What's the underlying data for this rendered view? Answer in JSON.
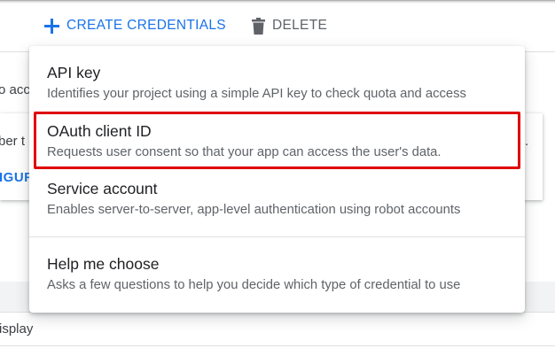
{
  "toolbar": {
    "create_label": "CREATE CREDENTIALS",
    "delete_label": "DELETE"
  },
  "background": {
    "fragment_1": "o acc",
    "fragment_2": "ber t",
    "fragment_3": "IGUR",
    "fragment_4": "isplay"
  },
  "menu": {
    "items": [
      {
        "title": "API key",
        "description": "Identifies your project using a simple API key to check quota and access"
      },
      {
        "title": "OAuth client ID",
        "description": "Requests user consent so that your app can access the user's data."
      },
      {
        "title": "Service account",
        "description": "Enables server-to-server, app-level authentication using robot accounts"
      },
      {
        "title": "Help me choose",
        "description": "Asks a few questions to help you decide which type of credential to use"
      }
    ]
  },
  "colors": {
    "accent": "#1a73e8",
    "highlight": "#e00000",
    "muted_text": "#5f6368"
  }
}
